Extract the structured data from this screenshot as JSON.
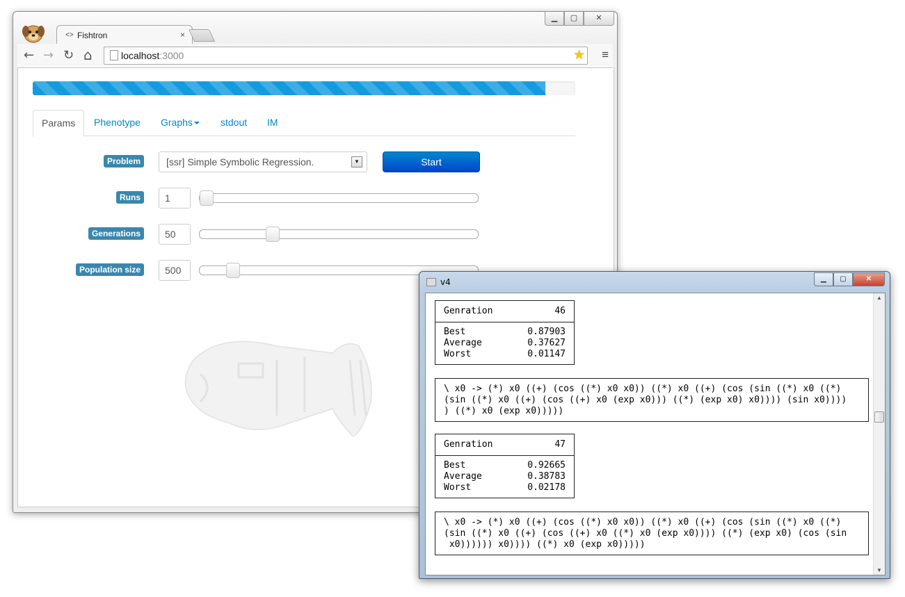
{
  "browser": {
    "tab_title": "Fishtron",
    "tab_close": "×",
    "window_buttons": {
      "minimize": "▁",
      "maximize": "▢",
      "close": "✕"
    },
    "nav": {
      "back": "←",
      "forward": "→",
      "reload": "↻",
      "home": "⌂"
    },
    "url_host": "localhost",
    "url_port": ":3000",
    "bookmark_icon": "★",
    "menu_icon": "≡"
  },
  "app": {
    "progress_percent": 94.5,
    "tabs": [
      {
        "label": "Params",
        "active": true
      },
      {
        "label": "Phenotype",
        "active": false
      },
      {
        "label": "Graphs",
        "active": false,
        "dropdown": true
      },
      {
        "label": "stdout",
        "active": false
      },
      {
        "label": "IM",
        "active": false
      }
    ],
    "problem": {
      "label": "Problem",
      "selected": "[ssr] Simple Symbolic Regression.",
      "arrow": "▼"
    },
    "start_label": "Start",
    "runs": {
      "label": "Runs",
      "value": "1",
      "slider_fraction": 0.0
    },
    "generations": {
      "label": "Generations",
      "value": "50",
      "slider_fraction": 0.25
    },
    "population": {
      "label": "Population size",
      "value": "500",
      "slider_fraction": 0.1
    }
  },
  "console": {
    "title": "v4",
    "window_buttons": {
      "minimize": "▁",
      "maximize": "▢",
      "close": "✕"
    },
    "scroll_up": "▲",
    "scroll_down": "▼",
    "blocks": [
      {
        "gen_label": "Genration",
        "gen_value": "46",
        "best_label": "Best",
        "best_value": "0.87903",
        "avg_label": "Average",
        "avg_value": "0.37627",
        "worst_label": "Worst",
        "worst_value": "0.01147",
        "expr_lines": [
          "\\ x0 -> (*) x0 ((+) (cos ((*) x0 x0)) ((*) x0 ((+) (cos (sin ((*) x0 ((*)",
          "(sin ((*) x0 ((+) (cos ((+) x0 (exp x0))) ((*) (exp x0) x0)))) (sin x0))))",
          ") ((*) x0 (exp x0)))))"
        ]
      },
      {
        "gen_label": "Genration",
        "gen_value": "47",
        "best_label": "Best",
        "best_value": "0.92665",
        "avg_label": "Average",
        "avg_value": "0.38783",
        "worst_label": "Worst",
        "worst_value": "0.02178",
        "expr_lines": [
          "\\ x0 -> (*) x0 ((+) (cos ((*) x0 x0)) ((*) x0 ((+) (cos (sin ((*) x0 ((*)",
          "(sin ((*) x0 ((+) (cos ((+) x0 ((*) x0 (exp x0)))) ((*) (exp x0) (cos (sin",
          " x0)))))) x0)))) ((*) x0 (exp x0)))))"
        ]
      }
    ]
  }
}
